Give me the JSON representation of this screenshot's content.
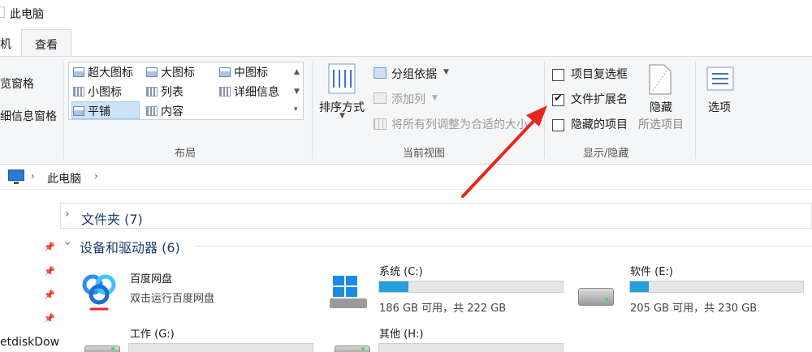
{
  "window": {
    "title": "此电脑"
  },
  "ribbon": {
    "tabs": [
      {
        "label": "机"
      },
      {
        "label": "查看"
      }
    ],
    "panes": {
      "items": [
        {
          "label": "览窗格"
        },
        {
          "label": "细信息窗格"
        }
      ]
    },
    "layout": {
      "group_label": "布局",
      "items": [
        {
          "label": "超大图标"
        },
        {
          "label": "大图标"
        },
        {
          "label": "中图标"
        },
        {
          "label": "小图标"
        },
        {
          "label": "列表"
        },
        {
          "label": "详细信息"
        },
        {
          "label": "平铺"
        },
        {
          "label": "内容"
        }
      ],
      "selected": "平铺"
    },
    "current_view": {
      "group_label": "当前视图",
      "sort_label": "排序方式",
      "group_by_label": "分组依据",
      "add_column_label": "添加列",
      "fit_columns_label": "将所有列调整为合适的大小"
    },
    "show_hide": {
      "group_label": "显示/隐藏",
      "checkboxes": [
        {
          "label": "项目复选框",
          "checked": false
        },
        {
          "label": "文件扩展名",
          "checked": true
        },
        {
          "label": "隐藏的项目",
          "checked": false
        }
      ],
      "hide_selected_label_1": "隐藏",
      "hide_selected_label_2": "所选项目",
      "options_label": "选项"
    }
  },
  "address": {
    "path_label": "此电脑",
    "separator": "›"
  },
  "sidebar": {
    "partial_label": "etdiskDow"
  },
  "content": {
    "folders_section": {
      "title": "文件夹 (7)"
    },
    "devices_section": {
      "title": "设备和驱动器 (6)"
    },
    "drives": [
      {
        "name": "百度网盘",
        "subtitle": "双击运行百度网盘"
      },
      {
        "name": "系统 (C:)",
        "size_text": "186 GB 可用，共 222 GB",
        "used_fraction": 0.16
      },
      {
        "name": "软件 (E:)",
        "size_text": "205 GB 可用，共 230 GB",
        "used_fraction": 0.11
      },
      {
        "name": "工作 (G:)"
      },
      {
        "name": "其他 (H:)"
      }
    ]
  },
  "colors": {
    "accent": "#26a0da",
    "arrow": "#e8261f",
    "ribbon_bg": "#f5f6f7",
    "section_text": "#1e3c70"
  }
}
